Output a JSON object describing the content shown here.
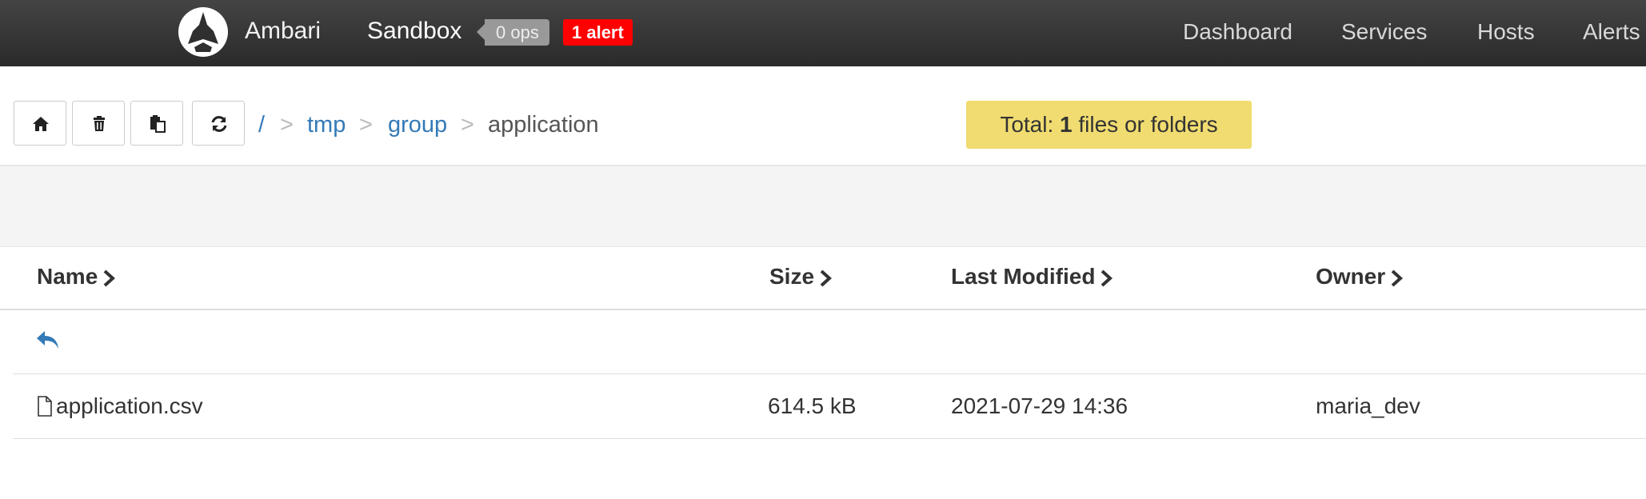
{
  "header": {
    "brand": "Ambari",
    "cluster_name": "Sandbox",
    "ops_badge": "0 ops",
    "alert_badge": "1 alert",
    "nav": [
      "Dashboard",
      "Services",
      "Hosts",
      "Alerts"
    ]
  },
  "toolbar": {
    "buttons": [
      "home-icon",
      "trash-icon",
      "paste-icon",
      "refresh-icon"
    ],
    "breadcrumb": {
      "root": "/",
      "separator": ">",
      "items": [
        "tmp",
        "group"
      ],
      "current": "application"
    },
    "total": {
      "prefix": "Total:",
      "count": "1",
      "suffix": "files or folders"
    }
  },
  "table": {
    "columns": [
      "Name",
      "Size",
      "Last Modified",
      "Owner"
    ],
    "rows": [
      {
        "name": "application.csv",
        "size": "614.5 kB",
        "modified": "2021-07-29 14:36",
        "owner": "maria_dev"
      }
    ]
  },
  "colors": {
    "header_bg": "#333333",
    "link": "#337ab7",
    "total_bg": "#f0dc70",
    "alert": "#ff0000"
  }
}
